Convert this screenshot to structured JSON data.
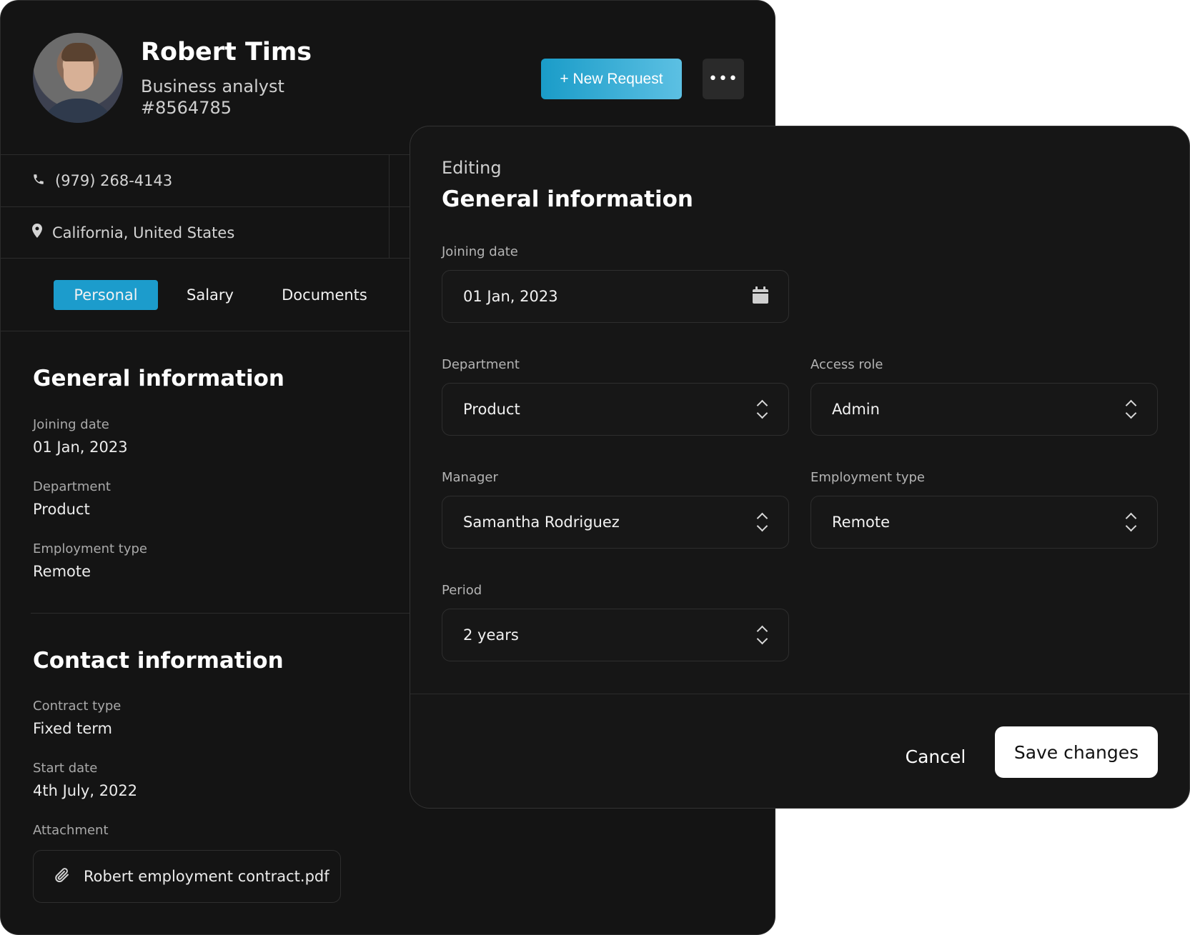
{
  "profile": {
    "name": "Robert Tims",
    "role": "Business analyst",
    "employee_id": "#8564785",
    "new_request_label": "+ New Request",
    "more_label": "•••",
    "phone": "(979) 268-4143",
    "location": "California, United States",
    "tabs": [
      {
        "label": "Personal",
        "active": true
      },
      {
        "label": "Salary",
        "active": false
      },
      {
        "label": "Documents",
        "active": false
      }
    ],
    "general": {
      "title": "General information",
      "joining_date_label": "Joining date",
      "joining_date": "01 Jan, 2023",
      "department_label": "Department",
      "department": "Product",
      "employment_type_label": "Employment type",
      "employment_type": "Remote"
    },
    "contact": {
      "title": "Contact information",
      "contract_type_label": "Contract type",
      "contract_type": "Fixed term",
      "start_date_label": "Start date",
      "start_date": "4th July, 2022",
      "attachment_label": "Attachment",
      "attachment_file": "Robert employment contract.pdf"
    }
  },
  "modal": {
    "editing_label": "Editing",
    "title": "General information",
    "joining_date_label": "Joining date",
    "joining_date": "01 Jan, 2023",
    "department_label": "Department",
    "department": "Product",
    "access_role_label": "Access role",
    "access_role": "Admin",
    "manager_label": "Manager",
    "manager": "Samantha Rodriguez",
    "employment_type_label": "Employment type",
    "employment_type": "Remote",
    "period_label": "Period",
    "period": "2 years",
    "cancel_label": "Cancel",
    "save_label": "Save changes"
  },
  "colors": {
    "accent": "#1c9ccc",
    "background": "#141414"
  }
}
